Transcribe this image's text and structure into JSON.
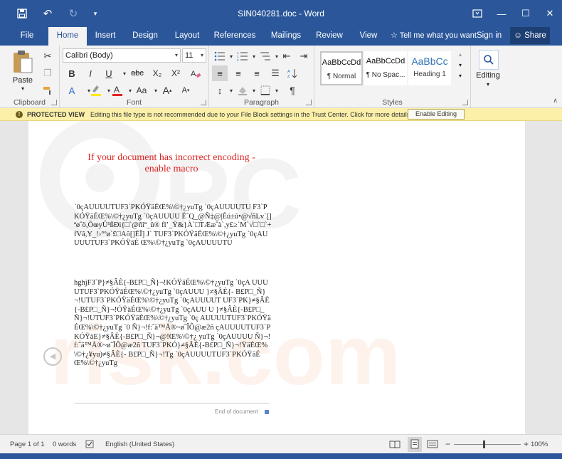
{
  "window": {
    "title": "SIN040281.doc - Word",
    "qat": {
      "save_icon": "save-icon",
      "undo_icon": "undo-icon",
      "redo_icon": "redo-icon",
      "customize_icon": "customize-qat-icon"
    },
    "controls": {
      "ribbon_options": "ribbon-display-options-icon",
      "minimize": "minimize-icon",
      "maximize": "maximize-icon",
      "close": "close-icon"
    }
  },
  "tabs": [
    {
      "label": "File"
    },
    {
      "label": "Home",
      "active": true
    },
    {
      "label": "Insert"
    },
    {
      "label": "Design"
    },
    {
      "label": "Layout"
    },
    {
      "label": "References"
    },
    {
      "label": "Mailings"
    },
    {
      "label": "Review"
    },
    {
      "label": "View"
    }
  ],
  "tellme": "Tell me what you want",
  "signin": "Sign in",
  "share": "Share",
  "ribbon": {
    "clipboard": {
      "label": "Clipboard",
      "paste": "Paste"
    },
    "font": {
      "label": "Font",
      "family": "Calibri (Body)",
      "size": "11",
      "bold": "B",
      "italic": "I",
      "underline": "U",
      "strike": "abc",
      "sub": "X₂",
      "sup": "X²",
      "case": "Aa",
      "grow": "A",
      "shrink": "A"
    },
    "paragraph": {
      "label": "Paragraph"
    },
    "styles": {
      "label": "Styles",
      "items": [
        {
          "sample": "AaBbCcDd",
          "name": "¶ Normal"
        },
        {
          "sample": "AaBbCcDd",
          "name": "¶ No Spac..."
        },
        {
          "sample": "AaBbCc",
          "name": "Heading 1"
        }
      ]
    },
    "editing": {
      "label": "Editing"
    }
  },
  "protected_view": {
    "title": "PROTECTED VIEW",
    "message": "Editing this file type is not recommended due to your File Block settings in the Trust Center. Click for more details.",
    "button": "Enable Editing"
  },
  "document": {
    "warning_line1": "If your document has incorrect encoding -",
    "warning_line2": "enable macro",
    "para1": "`0çAUUUUTUF3`PKÓŸäÉŒ%\\©†¿yuTg `0çAUUUUTU F3`PKÓŸäÉŒ%\\©†¿yuTg `0çAUUUU ËˆQ_@Ñ‡@|Éú±û•@√ñLv`[]ªøˆö,ÕœyÛ¹ßÐi{□`@ñîª_û® fl’_Ÿ&}À`□TÆæˆà`,y£≥`M`√□`□`+fVâ,Y_!›°ºø`£□Aõ[]ËÎ] J` TUF3`PKÓŸäÉŒ%\\©†¿yuTg `0çAUUUUTUF3`PKÓŸäÉ Œ%\\©†¿yuTg `0çAUUUUTU",
    "para2": "hghjF3`P}≠§ÂÈ{-B£P□_Ñ}¬!KÓŸäÉŒ%\\©†¿yuTg `0çA UUUUTUF3`PKÓŸäÉŒ%\\©†¿yuTg `0çAUUU }≠§ÂÈ{- B£P□_Ñ}¬!UTUF3`PKÓŸäÉŒ%\\©†¿yuTg `0çAUUUUT UF3`PK}≠§ÂÈ{-B£P□_Ñ}¬!ÓŸäÉŒ%\\©†¿yuTg `0çAUU U }≠§ÂÈ{-B£P□_Ñ}¬!UTUF3`PKÓŸäÉŒ%\\©†¿yuTg `0ç AUUUUTUF3`PKÓŸäÉŒ%\\©†¿yuTg `0 Ñ}¬!f:ˆä™Å®~øˆÎÔ@æ2ñ çAUUUUTUF3`PKÓŸäE}≠§ÂÈ{-B£P□_Ñ}¬@!Œ%\\©†¿ yuTg `0çAUUUU Ñ}¬!f:ˆä™Å®~øˆÎÔ@æ2ñ TUF3`PKÓ}≠§ÂÈ{-B£P□_Ñ}¬!ŸäÉŒ%\\©†¿¥yu)≠§ÂÈ{- B£P□_Ñ}¬!Tg `0çAUUUUTUF3`PKÓŸäÉŒ%\\©†¿yuTg",
    "end_of_document": "End of document"
  },
  "status": {
    "page": "Page 1 of 1",
    "words": "0 words",
    "language": "English (United States)",
    "zoom": "100%",
    "zoom_level": 0.45,
    "minus": "−",
    "plus": "+"
  },
  "colors": {
    "accent": "#2b579a",
    "warning_text": "#e02323",
    "protected_bar": "#fcf0a9"
  }
}
